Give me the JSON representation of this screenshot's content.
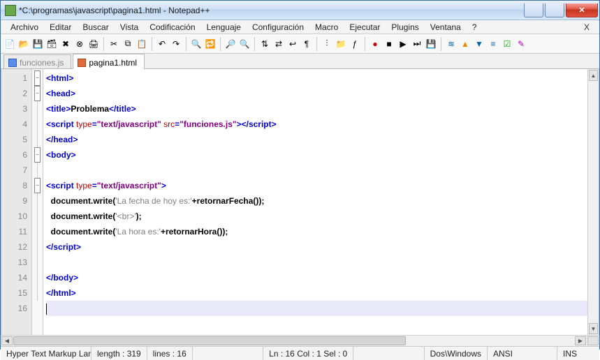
{
  "window": {
    "title": "*C:\\programas\\javascript\\pagina1.html - Notepad++"
  },
  "menu": {
    "items": [
      "Archivo",
      "Editar",
      "Buscar",
      "Vista",
      "Codificación",
      "Lenguaje",
      "Configuración",
      "Macro",
      "Ejecutar",
      "Plugins",
      "Ventana",
      "?"
    ],
    "x": "X"
  },
  "tabs": [
    {
      "label": "funciones.js",
      "active": false
    },
    {
      "label": "pagina1.html",
      "active": true
    }
  ],
  "lines": [
    {
      "n": 1,
      "fold": "min",
      "seg": [
        {
          "c": "tag",
          "t": "<html>"
        }
      ]
    },
    {
      "n": 2,
      "fold": "min",
      "seg": [
        {
          "c": "tag",
          "t": "<head>"
        }
      ]
    },
    {
      "n": 3,
      "fold": "line",
      "seg": [
        {
          "c": "tag",
          "t": "<title>"
        },
        {
          "c": "txt",
          "t": "Problema"
        },
        {
          "c": "tag",
          "t": "</title>"
        }
      ]
    },
    {
      "n": 4,
      "fold": "line",
      "seg": [
        {
          "c": "tag",
          "t": "<script "
        },
        {
          "c": "attr",
          "t": "type"
        },
        {
          "c": "tag",
          "t": "="
        },
        {
          "c": "str",
          "t": "\"text/javascript\""
        },
        {
          "c": "tag",
          "t": " "
        },
        {
          "c": "attr",
          "t": "src"
        },
        {
          "c": "tag",
          "t": "="
        },
        {
          "c": "str",
          "t": "\"funciones.js\""
        },
        {
          "c": "tag",
          "t": ">"
        },
        {
          "c": "tag",
          "t": "</script>"
        }
      ]
    },
    {
      "n": 5,
      "fold": "line",
      "seg": [
        {
          "c": "tag",
          "t": "</head>"
        }
      ]
    },
    {
      "n": 6,
      "fold": "min",
      "seg": [
        {
          "c": "tag",
          "t": "<body>"
        }
      ]
    },
    {
      "n": 7,
      "fold": "line",
      "seg": []
    },
    {
      "n": 8,
      "fold": "min",
      "seg": [
        {
          "c": "tag",
          "t": "<script "
        },
        {
          "c": "attr",
          "t": "type"
        },
        {
          "c": "tag",
          "t": "="
        },
        {
          "c": "str",
          "t": "\"text/javascript\""
        },
        {
          "c": "tag",
          "t": ">"
        }
      ]
    },
    {
      "n": 9,
      "fold": "line",
      "seg": [
        {
          "c": "txt",
          "t": "  document.write("
        },
        {
          "c": "gray",
          "t": "'La fecha de hoy es:'"
        },
        {
          "c": "txt",
          "t": "+retornarFecha());"
        }
      ]
    },
    {
      "n": 10,
      "fold": "line",
      "seg": [
        {
          "c": "txt",
          "t": "  document.write("
        },
        {
          "c": "gray",
          "t": "'<br>'"
        },
        {
          "c": "txt",
          "t": ");"
        }
      ]
    },
    {
      "n": 11,
      "fold": "line",
      "seg": [
        {
          "c": "txt",
          "t": "  document.write("
        },
        {
          "c": "gray",
          "t": "'La hora es:'"
        },
        {
          "c": "txt",
          "t": "+retornarHora());"
        }
      ]
    },
    {
      "n": 12,
      "fold": "line",
      "seg": [
        {
          "c": "tag",
          "t": "</script>"
        }
      ]
    },
    {
      "n": 13,
      "fold": "line",
      "seg": []
    },
    {
      "n": 14,
      "fold": "line",
      "seg": [
        {
          "c": "tag",
          "t": "</body>"
        }
      ]
    },
    {
      "n": 15,
      "fold": "line",
      "seg": [
        {
          "c": "tag",
          "t": "</html>"
        }
      ]
    },
    {
      "n": 16,
      "fold": "",
      "seg": [],
      "current": true
    }
  ],
  "status": {
    "lang": "Hyper Text Markup Langu",
    "length": "length : 319",
    "lines": "lines : 16",
    "pos": "Ln : 16   Col : 1   Sel : 0",
    "eol": "Dos\\Windows",
    "enc": "ANSI",
    "ins": "INS"
  }
}
